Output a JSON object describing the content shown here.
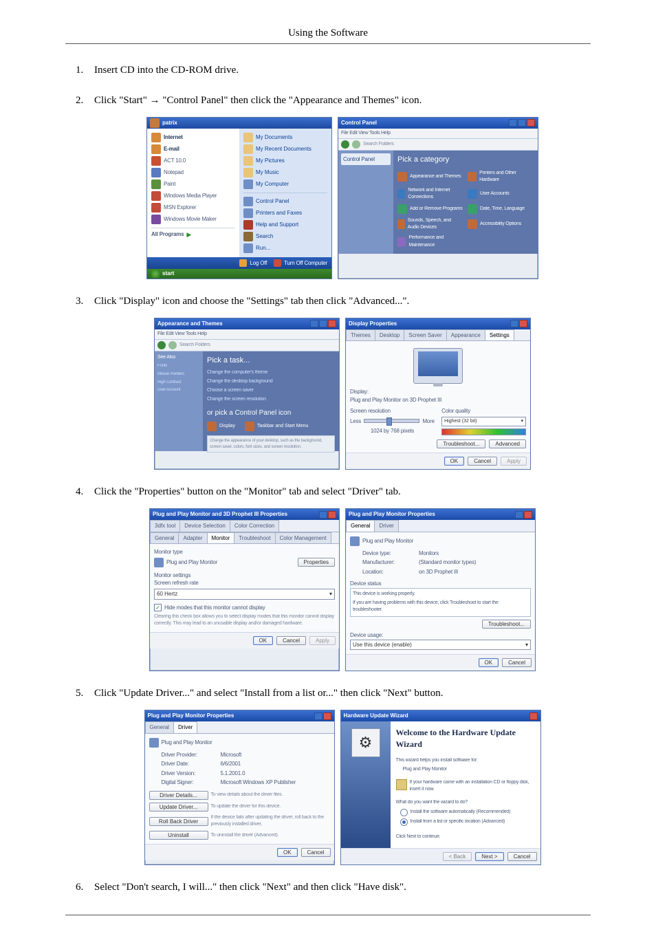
{
  "header": {
    "title": "Using the Software"
  },
  "steps": {
    "s1": "Insert CD into the CD-ROM drive.",
    "s2": "Click \"Start\" → \"Control Panel\" then click the \"Appearance and Themes\" icon.",
    "s3": "Click \"Display\" icon and choose the \"Settings\" tab then click \"Advanced...\".",
    "s4": "Click the \"Properties\" button on the \"Monitor\" tab and select \"Driver\" tab.",
    "s5": "Click \"Update Driver...\" and select \"Install from a list or...\" then click \"Next\" button.",
    "s6": "Select \"Don't search, I will...\" then click \"Next\" and then click \"Have disk\"."
  },
  "fig2": {
    "left": {
      "title": "patrix",
      "links": [
        "My Documents",
        "My Recent Documents",
        "My Pictures",
        "My Music",
        "My Computer"
      ],
      "links2": [
        "Control Panel",
        "Printers and Faxes",
        "Help and Support",
        "Search",
        "Run..."
      ],
      "allprog": "All Programs",
      "logoff": "Log Off",
      "shutdown": "Turn Off Computer",
      "start": "start"
    },
    "right": {
      "title": "Control Panel",
      "breadcrumb": "Control Panel",
      "heading": "Pick a category",
      "cats": [
        "Appearance and Themes",
        "Network and Internet Connections",
        "Add or Remove Programs",
        "Sounds, Speech, and Audio Devices",
        "Performance and Maintenance",
        "Printers and Other Hardware",
        "User Accounts",
        "Date, Time, Language",
        "Accessibility Options"
      ]
    }
  },
  "fig3": {
    "left": {
      "title": "Appearance and Themes",
      "heading": "Pick a task...",
      "tasks": [
        "Change the computer's theme",
        "Change the desktop background",
        "Choose a screen saver",
        "Change the screen resolution"
      ],
      "panel_head": "or pick a Control Panel icon",
      "icons": [
        "Display",
        "Taskbar and Start Menu"
      ]
    },
    "right": {
      "title": "Display Properties",
      "tabs": [
        "Themes",
        "Desktop",
        "Screen Saver",
        "Appearance",
        "Settings"
      ],
      "label": "Display:",
      "disp": "Plug and Play Monitor on 3D Prophet III",
      "res_label": "Screen resolution",
      "quality_label": "Color quality",
      "res_less": "Less",
      "res_more": "More",
      "res_val": "1024 by 768 pixels",
      "quality_val": "Highest (32 bit)",
      "troubleshoot": "Troubleshoot...",
      "advanced": "Advanced",
      "ok": "OK",
      "cancel": "Cancel",
      "apply": "Apply"
    }
  },
  "fig4": {
    "left": {
      "title": "Plug and Play Monitor and 3D Prophet III Properties",
      "tabs": [
        "General",
        "Adapter",
        "Monitor",
        "Troubleshoot",
        "Color Management"
      ],
      "tabs2": [
        "3dfx tool",
        "Device Selection",
        "Color Correction"
      ],
      "mtype_label": "Monitor type",
      "mtype": "Plug and Play Monitor",
      "props": "Properties",
      "settings_label": "Monitor settings",
      "refresh_label": "Screen refresh rate",
      "hz": "60 Hertz",
      "chk": "Hide modes that this monitor cannot display",
      "note": "Clearing this check box allows you to select display modes that this monitor cannot display correctly. This may lead to an unusable display and/or damaged hardware.",
      "ok": "OK",
      "cancel": "Cancel",
      "apply": "Apply"
    },
    "right": {
      "title": "Plug and Play Monitor Properties",
      "tabs": [
        "General",
        "Driver"
      ],
      "head": "Plug and Play Monitor",
      "dt_label": "Device type:",
      "dt": "Monitors",
      "mf_label": "Manufacturer:",
      "mf": "(Standard monitor types)",
      "loc_label": "Location:",
      "loc": "on 3D Prophet III",
      "status_label": "Device status",
      "status": "This device is working properly.",
      "status2": "If you are having problems with this device, click Troubleshoot to start the troubleshooter.",
      "tshoot": "Troubleshoot...",
      "usage_label": "Device usage:",
      "usage": "Use this device (enable)",
      "ok": "OK",
      "cancel": "Cancel"
    }
  },
  "fig5": {
    "left": {
      "title": "Plug and Play Monitor Properties",
      "tabs": [
        "General",
        "Driver"
      ],
      "head": "Plug and Play Monitor",
      "dp_label": "Driver Provider:",
      "dp": "Microsoft",
      "dd_label": "Driver Date:",
      "dd": "6/6/2001",
      "dv_label": "Driver Version:",
      "dv": "5.1.2001.0",
      "ds_label": "Digital Signer:",
      "ds": "Microsoft Windows XP Publisher",
      "b1": "Driver Details...",
      "b1d": "To view details about the driver files.",
      "b2": "Update Driver...",
      "b2d": "To update the driver for this device.",
      "b3": "Roll Back Driver",
      "b3d": "If the device fails after updating the driver, roll back to the previously installed driver.",
      "b4": "Uninstall",
      "b4d": "To uninstall the driver (Advanced).",
      "ok": "OK",
      "cancel": "Cancel"
    },
    "right": {
      "title": "Hardware Update Wizard",
      "welcome": "Welcome to the Hardware Update Wizard",
      "sub": "This wizard helps you install software for:",
      "dev": "Plug and Play Monitor",
      "cd": "If your hardware came with an installation CD or floppy disk, insert it now.",
      "ask": "What do you want the wizard to do?",
      "opt1": "Install the software automatically (Recommended)",
      "opt2": "Install from a list or specific location (Advanced)",
      "cont": "Click Next to continue.",
      "back": "< Back",
      "next": "Next >",
      "cancel": "Cancel"
    }
  }
}
